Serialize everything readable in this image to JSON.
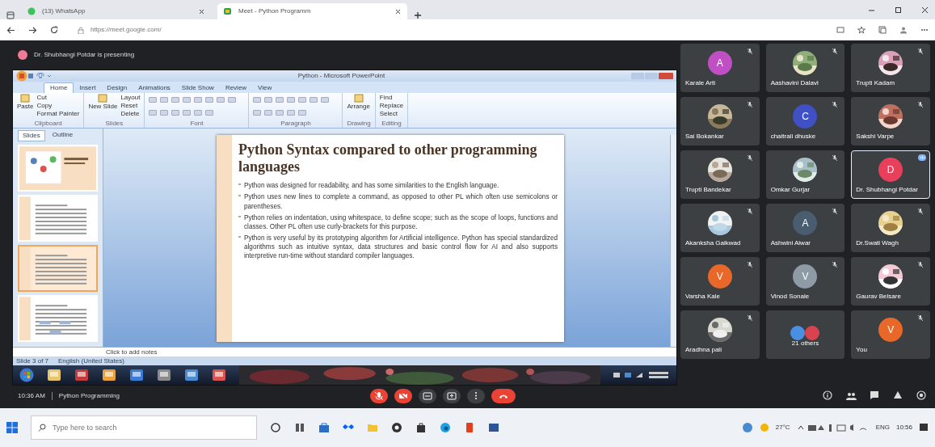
{
  "browser": {
    "tabs": [
      {
        "label": "(13) WhatsApp",
        "selected": false
      },
      {
        "label": "Meet - Python Programm",
        "selected": true
      }
    ],
    "url": "https://meet.google.com/"
  },
  "presenter_banner": "Dr. Shubhangi Potdar is presenting",
  "presentation": {
    "app_title": "Python - Microsoft PowerPoint",
    "ribbon_tabs": [
      {
        "label": "Home",
        "selected": true
      },
      {
        "label": "Insert",
        "selected": false
      },
      {
        "label": "Design",
        "selected": false
      },
      {
        "label": "Animations",
        "selected": false
      },
      {
        "label": "Slide Show",
        "selected": false
      },
      {
        "label": "Review",
        "selected": false
      },
      {
        "label": "View",
        "selected": false
      }
    ],
    "ribbon_groups": [
      {
        "label": "Clipboard",
        "kind": "buttons",
        "big": "Paste",
        "items": [
          "Cut",
          "Copy",
          "Format Painter"
        ]
      },
      {
        "label": "Slides",
        "kind": "buttons",
        "big": "New Slide",
        "items": [
          "Layout",
          "Reset",
          "Delete"
        ]
      },
      {
        "label": "Font",
        "kind": "tools"
      },
      {
        "label": "Paragraph",
        "kind": "tools"
      },
      {
        "label": "Drawing",
        "kind": "buttons",
        "big": "Arrange"
      },
      {
        "label": "Editing",
        "kind": "buttons",
        "items": [
          "Find",
          "Replace",
          "Select"
        ]
      }
    ],
    "panel_tabs": [
      {
        "label": "Slides",
        "selected": true
      },
      {
        "label": "Outline",
        "selected": false
      }
    ],
    "thumbnails": [
      {
        "selected": false
      },
      {
        "selected": false
      },
      {
        "selected": true
      },
      {
        "selected": false
      }
    ],
    "slide": {
      "title": "Python Syntax compared to other programming languages",
      "bullets": [
        "Python was designed for readability, and has some similarities to the English language.",
        "Python uses new lines to complete a command, as opposed to other PL which often use semicolons or parentheses.",
        "Python relies on indentation, using whitespace, to define scope; such as the scope of loops, functions and classes. Other PL often use curly-brackets for this purpose.",
        "Python is very useful by its prototyping algorithm for Artificial intelligence. Python has special standardized algorithms such as intuitive syntax, data structures and basic control flow for AI and also supports interpretive run-time without standard compiler languages."
      ]
    },
    "notes_placeholder": "Click to add notes",
    "status": [
      "Slide 3 of 7",
      "English (United States)"
    ]
  },
  "tiles": [
    {
      "name": "Karale Arti",
      "kind": "letter",
      "letter": "A",
      "color": "#c04fc4",
      "muted": true,
      "highlighted": false
    },
    {
      "name": "Aashavini Dalavi",
      "muted": true,
      "highlighted": false
    },
    {
      "name": "Trupti Kadam",
      "muted": true,
      "highlighted": false
    },
    {
      "name": "Sai Bokankar",
      "muted": true,
      "highlighted": false
    },
    {
      "name": "chaitrali dhuske",
      "kind": "letter",
      "letter": "C",
      "color": "#3f51c4",
      "muted": true,
      "highlighted": false
    },
    {
      "name": "Sakshi Varpe",
      "muted": true,
      "highlighted": false
    },
    {
      "name": "Trupti Bandekar",
      "muted": true,
      "highlighted": false
    },
    {
      "name": "Omkar Gurjar",
      "muted": true,
      "highlighted": false
    },
    {
      "name": "Dr. Shubhangi Potdar",
      "kind": "letter",
      "letter": "D",
      "color": "#e8405a",
      "muted": false,
      "highlighted": true
    },
    {
      "name": "Akanksha Gaikwad",
      "muted": true,
      "highlighted": false
    },
    {
      "name": "Ashwini Aiwar",
      "kind": "letter",
      "letter": "A",
      "color": "#4a5d70",
      "muted": true,
      "highlighted": false
    },
    {
      "name": "Dr.Swati Wagh",
      "muted": true,
      "highlighted": false
    },
    {
      "name": "Varsha Kale",
      "kind": "letter",
      "letter": "V",
      "color": "#e8682a",
      "muted": true,
      "highlighted": false
    },
    {
      "name": "Vinod Sonale",
      "kind": "letter",
      "letter": "V",
      "color": "#8e9aa6",
      "muted": true,
      "highlighted": false
    },
    {
      "name": "Gaurav Belsare",
      "muted": true,
      "highlighted": false
    },
    {
      "name": "Aradhna pali",
      "muted": true,
      "highlighted": false
    },
    {
      "name": "21 others",
      "kind": "group",
      "muted": false,
      "highlighted": false
    },
    {
      "name": "You",
      "kind": "letter",
      "letter": "V",
      "color": "#e8682a",
      "muted": true,
      "highlighted": false
    }
  ],
  "meeting": {
    "time": "10:36 AM",
    "name": "Python Programming"
  },
  "controls": [
    {
      "kind": "mic"
    },
    {
      "kind": "camera"
    },
    {
      "kind": "captions"
    },
    {
      "kind": "present"
    },
    {
      "kind": "more"
    },
    {
      "kind": "end"
    }
  ],
  "side_controls": [
    {
      "kind": "info"
    },
    {
      "kind": "people"
    },
    {
      "kind": "chat"
    },
    {
      "kind": "activities"
    },
    {
      "kind": "host"
    }
  ],
  "taskbar": {
    "search_placeholder": "Type here to search",
    "temperature": "27°C",
    "language": "ENG",
    "time": "10:56"
  }
}
